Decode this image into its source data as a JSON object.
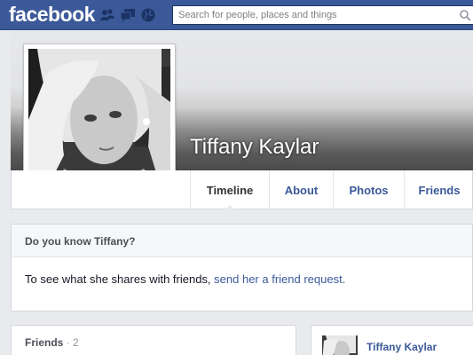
{
  "header": {
    "logo": "facebook",
    "search": {
      "placeholder": "Search for people, places and things",
      "value": ""
    }
  },
  "profile": {
    "name": "Tiffany Kaylar",
    "tabs": [
      {
        "label": "Timeline",
        "active": true
      },
      {
        "label": "About",
        "active": false
      },
      {
        "label": "Photos",
        "active": false
      },
      {
        "label": "Friends",
        "active": false
      }
    ]
  },
  "know_box": {
    "title": "Do you know Tiffany?",
    "text": "To see what she shares with friends, ",
    "link": "send her a friend request."
  },
  "friends_box": {
    "title": "Friends",
    "count": " · 2"
  },
  "post": {
    "author": "Tiffany Kaylar"
  },
  "colors": {
    "brand": "#3b5998",
    "link": "#3b5998",
    "background": "#e9eaed"
  },
  "icons": [
    "friend-requests-icon",
    "messages-icon",
    "notifications-icon",
    "search-icon"
  ]
}
